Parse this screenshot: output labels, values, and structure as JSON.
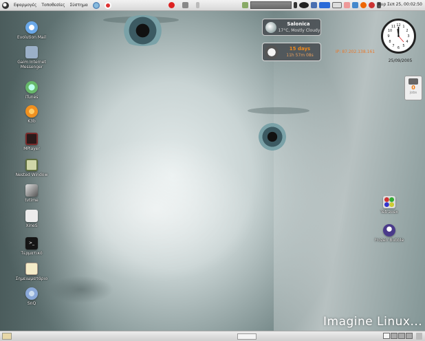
{
  "top_panel": {
    "menu": [
      "Εφαρμογές",
      "Τοποθεσίες",
      "Σύστημα"
    ],
    "launchers": [
      "globe-icon",
      "help-icon",
      "power-icon",
      "network-icon",
      "battery-icon"
    ],
    "clock": "Κυρ Σεπ 25, 00:02:50"
  },
  "desktop_icons": [
    {
      "name": "evolution-mail",
      "label": "Evolution Mail",
      "icon": "mail-icon",
      "color": "#6aa8e8"
    },
    {
      "name": "gaim",
      "label": "Gaim Internet Messenger",
      "icon": "messenger-icon",
      "color": "#9bb0c8"
    },
    {
      "name": "itunes",
      "label": "iTunes",
      "icon": "music-icon",
      "color": "#67b86a"
    },
    {
      "name": "k3b",
      "label": "K3b",
      "icon": "disc-icon",
      "color": "#f09020"
    },
    {
      "name": "mplayer",
      "label": "MPlayer",
      "icon": "film-icon",
      "color": "#7a2a2a"
    },
    {
      "name": "nested-window",
      "label": "Nested Window",
      "icon": "window-icon",
      "color": "#5e6e40"
    },
    {
      "name": "ivtime",
      "label": "tvtime",
      "icon": "tv-icon",
      "color": "#7a7a7a"
    },
    {
      "name": "xine",
      "label": "XineS",
      "icon": "video-icon",
      "color": "#d8d8d8"
    },
    {
      "name": "terminal",
      "label": "Τερματικό",
      "icon": "terminal-icon",
      "color": "#222222"
    },
    {
      "name": "editor",
      "label": "Σημειωματάριο",
      "icon": "notepad-icon",
      "color": "#e8d8a0"
    },
    {
      "name": "snq",
      "label": "SnQ",
      "icon": "globe-icon",
      "color": "#8aa8d8"
    }
  ],
  "right_icons": [
    {
      "name": "tetravex",
      "label": "Tetravex",
      "icon": "puzzle-icon",
      "color": "#5a8a5a"
    },
    {
      "name": "frozen-bubble",
      "label": "Frozen Bubble",
      "icon": "penguin-icon",
      "color": "#7a5aa8"
    }
  ],
  "weather": {
    "city": "Salonica",
    "condition": "17°C, Mostly Cloudy"
  },
  "uptime": {
    "days": "15 days",
    "hours": "11h 57m 08s"
  },
  "ip": "IP: 87.202.138.161",
  "date": "25/09/2005",
  "printer": {
    "count": "0",
    "unit": "jobs"
  },
  "brand": "Imagine Linux...",
  "colors": {
    "accent": "#f08a1c",
    "panel": "#e0e0e0"
  }
}
